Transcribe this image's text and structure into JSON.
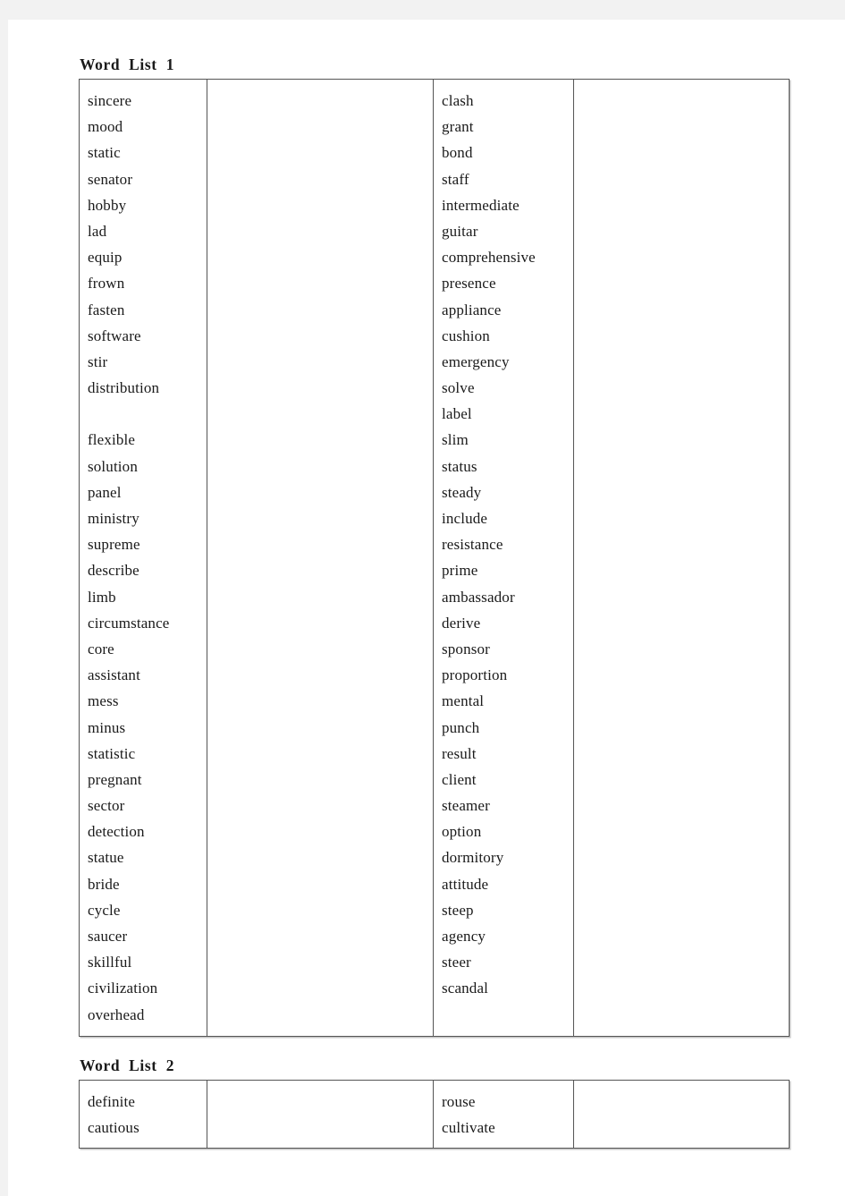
{
  "document": {
    "page_background": "#f2f2f2",
    "sheet_background": "#ffffff",
    "text_color": "#1a1a1a",
    "border_color": "#555555",
    "dashed_separator_color": "#777777"
  },
  "sections": [
    {
      "heading": "Word List 1",
      "columns": {
        "words_left": [
          "sincere",
          "mood",
          "static",
          "senator",
          "hobby",
          "lad",
          "equip",
          "frown",
          "fasten",
          "software",
          "stir",
          "distribution",
          "",
          "flexible",
          "solution",
          "panel",
          "ministry",
          "supreme",
          "describe",
          "limb",
          "circumstance",
          "core",
          "assistant",
          "mess",
          "minus",
          "statistic",
          "pregnant",
          "sector",
          "detection",
          "statue",
          "bride",
          "cycle",
          "saucer",
          "skillful",
          "civilization",
          "overhead"
        ],
        "answers_left": [],
        "words_right": [
          "clash",
          "grant",
          "bond",
          "staff",
          "intermediate",
          "guitar",
          "comprehensive",
          "presence",
          "appliance",
          "cushion",
          "emergency",
          "solve",
          "label",
          "slim",
          "status",
          "steady",
          "include",
          "resistance",
          "prime",
          "ambassador",
          "derive",
          "sponsor",
          "proportion",
          "mental",
          "punch",
          "result",
          "client",
          "steamer",
          "option",
          "dormitory",
          "attitude",
          "steep",
          "agency",
          "steer",
          "scandal"
        ],
        "answers_right": []
      }
    },
    {
      "heading": "Word List 2",
      "columns": {
        "words_left": [
          "definite",
          "cautious"
        ],
        "answers_left": [],
        "words_right": [
          "rouse",
          "cultivate"
        ],
        "answers_right": []
      }
    }
  ]
}
